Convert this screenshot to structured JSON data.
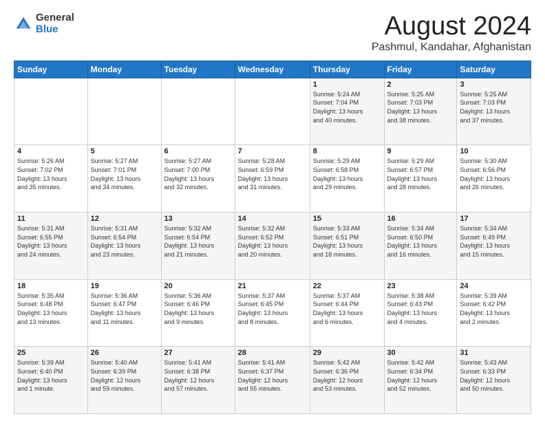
{
  "logo": {
    "general": "General",
    "blue": "Blue"
  },
  "header": {
    "month": "August 2024",
    "location": "Pashmul, Kandahar, Afghanistan"
  },
  "weekdays": [
    "Sunday",
    "Monday",
    "Tuesday",
    "Wednesday",
    "Thursday",
    "Friday",
    "Saturday"
  ],
  "weeks": [
    [
      {
        "day": "",
        "info": ""
      },
      {
        "day": "",
        "info": ""
      },
      {
        "day": "",
        "info": ""
      },
      {
        "day": "",
        "info": ""
      },
      {
        "day": "1",
        "info": "Sunrise: 5:24 AM\nSunset: 7:04 PM\nDaylight: 13 hours\nand 40 minutes."
      },
      {
        "day": "2",
        "info": "Sunrise: 5:25 AM\nSunset: 7:03 PM\nDaylight: 13 hours\nand 38 minutes."
      },
      {
        "day": "3",
        "info": "Sunrise: 5:25 AM\nSunset: 7:03 PM\nDaylight: 13 hours\nand 37 minutes."
      }
    ],
    [
      {
        "day": "4",
        "info": "Sunrise: 5:26 AM\nSunset: 7:02 PM\nDaylight: 13 hours\nand 35 minutes."
      },
      {
        "day": "5",
        "info": "Sunrise: 5:27 AM\nSunset: 7:01 PM\nDaylight: 13 hours\nand 34 minutes."
      },
      {
        "day": "6",
        "info": "Sunrise: 5:27 AM\nSunset: 7:00 PM\nDaylight: 13 hours\nand 32 minutes."
      },
      {
        "day": "7",
        "info": "Sunrise: 5:28 AM\nSunset: 6:59 PM\nDaylight: 13 hours\nand 31 minutes."
      },
      {
        "day": "8",
        "info": "Sunrise: 5:29 AM\nSunset: 6:58 PM\nDaylight: 13 hours\nand 29 minutes."
      },
      {
        "day": "9",
        "info": "Sunrise: 5:29 AM\nSunset: 6:57 PM\nDaylight: 13 hours\nand 28 minutes."
      },
      {
        "day": "10",
        "info": "Sunrise: 5:30 AM\nSunset: 6:56 PM\nDaylight: 13 hours\nand 26 minutes."
      }
    ],
    [
      {
        "day": "11",
        "info": "Sunrise: 5:31 AM\nSunset: 6:55 PM\nDaylight: 13 hours\nand 24 minutes."
      },
      {
        "day": "12",
        "info": "Sunrise: 5:31 AM\nSunset: 6:54 PM\nDaylight: 13 hours\nand 23 minutes."
      },
      {
        "day": "13",
        "info": "Sunrise: 5:32 AM\nSunset: 6:54 PM\nDaylight: 13 hours\nand 21 minutes."
      },
      {
        "day": "14",
        "info": "Sunrise: 5:32 AM\nSunset: 6:52 PM\nDaylight: 13 hours\nand 20 minutes."
      },
      {
        "day": "15",
        "info": "Sunrise: 5:33 AM\nSunset: 6:51 PM\nDaylight: 13 hours\nand 18 minutes."
      },
      {
        "day": "16",
        "info": "Sunrise: 5:34 AM\nSunset: 6:50 PM\nDaylight: 13 hours\nand 16 minutes."
      },
      {
        "day": "17",
        "info": "Sunrise: 5:34 AM\nSunset: 6:49 PM\nDaylight: 13 hours\nand 15 minutes."
      }
    ],
    [
      {
        "day": "18",
        "info": "Sunrise: 5:35 AM\nSunset: 6:48 PM\nDaylight: 13 hours\nand 13 minutes."
      },
      {
        "day": "19",
        "info": "Sunrise: 5:36 AM\nSunset: 6:47 PM\nDaylight: 13 hours\nand 11 minutes."
      },
      {
        "day": "20",
        "info": "Sunrise: 5:36 AM\nSunset: 6:46 PM\nDaylight: 13 hours\nand 9 minutes."
      },
      {
        "day": "21",
        "info": "Sunrise: 5:37 AM\nSunset: 6:45 PM\nDaylight: 13 hours\nand 8 minutes."
      },
      {
        "day": "22",
        "info": "Sunrise: 5:37 AM\nSunset: 6:44 PM\nDaylight: 13 hours\nand 6 minutes."
      },
      {
        "day": "23",
        "info": "Sunrise: 5:38 AM\nSunset: 6:43 PM\nDaylight: 13 hours\nand 4 minutes."
      },
      {
        "day": "24",
        "info": "Sunrise: 5:39 AM\nSunset: 6:42 PM\nDaylight: 13 hours\nand 2 minutes."
      }
    ],
    [
      {
        "day": "25",
        "info": "Sunrise: 5:39 AM\nSunset: 6:40 PM\nDaylight: 13 hours\nand 1 minute."
      },
      {
        "day": "26",
        "info": "Sunrise: 5:40 AM\nSunset: 6:39 PM\nDaylight: 12 hours\nand 59 minutes."
      },
      {
        "day": "27",
        "info": "Sunrise: 5:41 AM\nSunset: 6:38 PM\nDaylight: 12 hours\nand 57 minutes."
      },
      {
        "day": "28",
        "info": "Sunrise: 5:41 AM\nSunset: 6:37 PM\nDaylight: 12 hours\nand 55 minutes."
      },
      {
        "day": "29",
        "info": "Sunrise: 5:42 AM\nSunset: 6:36 PM\nDaylight: 12 hours\nand 53 minutes."
      },
      {
        "day": "30",
        "info": "Sunrise: 5:42 AM\nSunset: 6:34 PM\nDaylight: 12 hours\nand 52 minutes."
      },
      {
        "day": "31",
        "info": "Sunrise: 5:43 AM\nSunset: 6:33 PM\nDaylight: 12 hours\nand 50 minutes."
      }
    ]
  ]
}
